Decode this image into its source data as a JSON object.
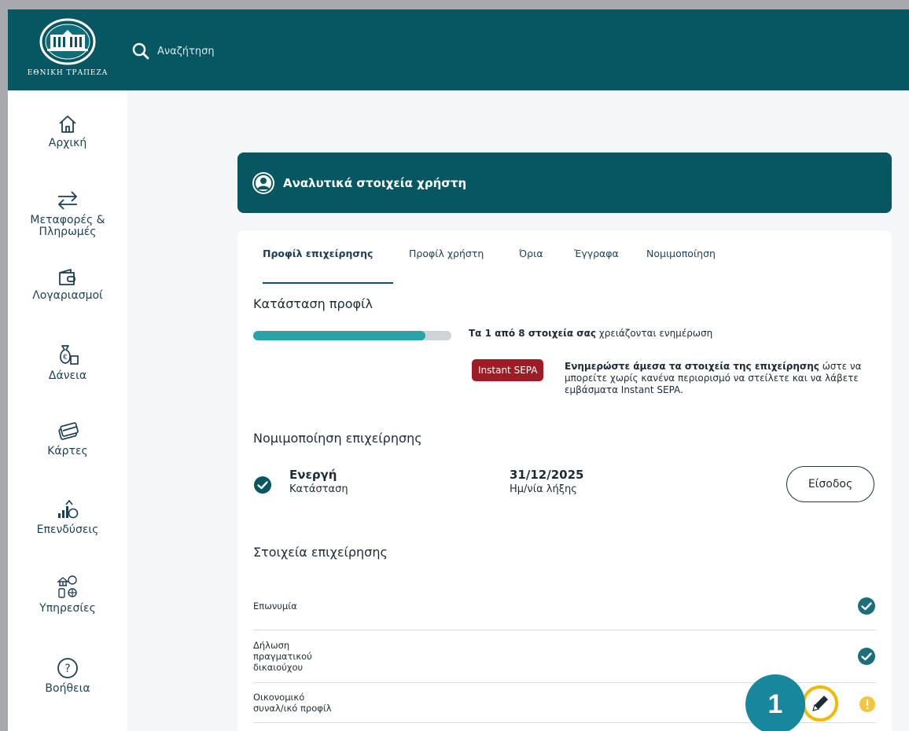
{
  "header": {
    "logo_text": "ΕΘΝΙΚΗ ΤΡΑΠΕΖΑ",
    "search_placeholder": "Αναζήτηση"
  },
  "sidebar": {
    "items": [
      {
        "label": "Αρχική",
        "icon": "home-icon"
      },
      {
        "label": "Μεταφορές &\nΠληρωμές",
        "icon": "transfer-arrows-icon"
      },
      {
        "label": "Λογαριασμοί",
        "icon": "wallet-icon"
      },
      {
        "label": "Δάνεια",
        "icon": "money-bag-icon"
      },
      {
        "label": "Κάρτες",
        "icon": "cards-icon"
      },
      {
        "label": "Επενδύσεις",
        "icon": "investments-icon"
      },
      {
        "label": "Υπηρεσίες",
        "icon": "services-icon"
      },
      {
        "label": "Βοήθεια",
        "icon": "help-icon"
      }
    ]
  },
  "banner": {
    "title": "Αναλυτικά στοιχεία χρήστη"
  },
  "tabs": [
    {
      "label": "Προφίλ επιχείρησης",
      "active": true
    },
    {
      "label": "Προφίλ χρήστη",
      "active": false
    },
    {
      "label": "Όρια",
      "active": false
    },
    {
      "label": "Έγγραφα",
      "active": false
    },
    {
      "label": "Νομιμοποίηση",
      "active": false
    }
  ],
  "profile_status": {
    "title": "Κατάσταση προφίλ",
    "progress_fraction": 0.87,
    "progress_bold": "Τα 1 από 8 στοιχεία σας",
    "progress_rest": "χρειάζονται ενημέρωση",
    "badge": "Instant SEPA",
    "note_bold": "Ενημερώστε άμεσα τα στοιχεία της επιχείρησης",
    "note_rest": "ώστε να μπορείτε χωρίς κανένα περιορισμό να στείλετε και να λάβετε εμβάσματα Instant SEPA."
  },
  "legalization": {
    "title": "Νομιμοποίηση επιχείρησης",
    "status_value": "Ενεργή",
    "status_caption": "Κατάσταση",
    "expiry_value": "31/12/2025",
    "expiry_caption": "Ημ/νία λήξης",
    "login_label": "Είσοδος"
  },
  "business_details": {
    "title": "Στοιχεία επιχείρησης",
    "rows": [
      {
        "label": "Επωνυμία",
        "status": "complete"
      },
      {
        "label": "Δήλωση\nπραγματικού\nδικαιούχου",
        "status": "complete"
      },
      {
        "label": "Οικονομικό\nσυναλ/ικό προφίλ",
        "status": "warning"
      }
    ]
  },
  "callout": {
    "number": "1"
  },
  "colors": {
    "brand_teal": "#065762",
    "progress": "#2aa2a7",
    "badge_red": "#9c1d25",
    "highlight_yellow": "#f5b800",
    "warning_yellow": "#f2c53d",
    "callout_blue": "#17879e"
  }
}
